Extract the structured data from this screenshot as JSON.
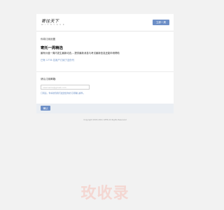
{
  "header": {
    "logo_text": "寄往天下",
    "logo_sub": "W I T H  Y O U R",
    "subscribe_label": "立即一周"
  },
  "main": {
    "prompt": "你将订阅设置",
    "title": "寄托一周精选",
    "description": "最有价值一周内发生最新动态,...提供最新消息与考试最新信息还能申请帮助",
    "subscriber_count": "已有 1778 名用户订阅了这份刊"
  },
  "form": {
    "email_label": "请认订阅邮箱:",
    "email_placeholder": "username@gmail.com",
    "hint": "订阅后，你将收到我们发送给你的订阅确认邮件。"
  },
  "footer": {
    "confirm_label": "确认",
    "copyright": "Copyright 2003-2021 GTER All Rights Reserved"
  },
  "watermark": "玫收录",
  "colors": {
    "accent": "#6d8fc7",
    "link": "#6a8fc5",
    "background": "#f2f2f2",
    "watermark": "#f4d7d2"
  }
}
